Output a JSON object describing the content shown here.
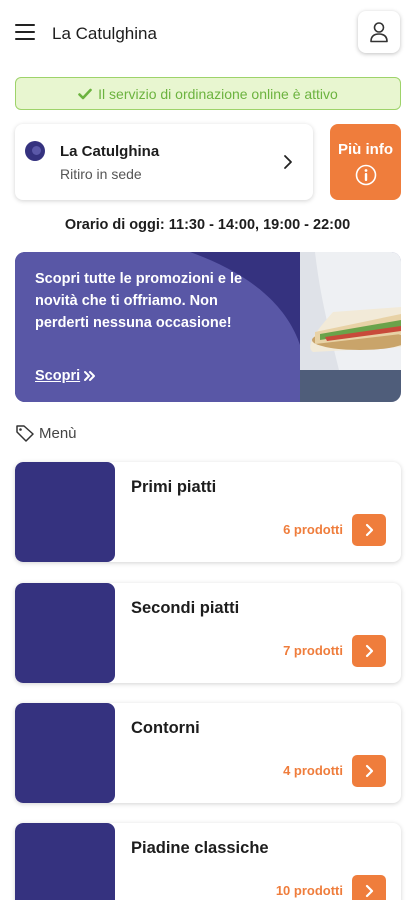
{
  "header": {
    "title": "La Catulghina",
    "menu_icon": "hamburger-menu-icon",
    "user_icon": "user-icon"
  },
  "status": {
    "text": "Il servizio di ordinazione online è attivo",
    "icon": "check-icon"
  },
  "restaurant": {
    "name": "La Catulghina",
    "mode": "Ritiro in sede"
  },
  "info_button": {
    "label": "Più info",
    "icon": "info-icon"
  },
  "hours": "Orario di oggi: 11:30 - 14:00, 19:00 - 22:00",
  "promo": {
    "text": "Scopri tutte le promozioni e le novità che ti offriamo. Non perderti nessuna occasione!",
    "link": "Scopri"
  },
  "menu_section": {
    "label": "Menù",
    "icon": "tag-icon"
  },
  "categories": [
    {
      "name": "Primi piatti",
      "count": "6 prodotti"
    },
    {
      "name": "Secondi piatti",
      "count": "7 prodotti"
    },
    {
      "name": "Contorni",
      "count": "4 prodotti"
    },
    {
      "name": "Piadine classiche",
      "count": "10 prodotti"
    }
  ],
  "colors": {
    "brand": "#35327f",
    "accent": "#ef7d3c",
    "success": "#6cb33f",
    "success_bg": "#e8f6d0"
  }
}
